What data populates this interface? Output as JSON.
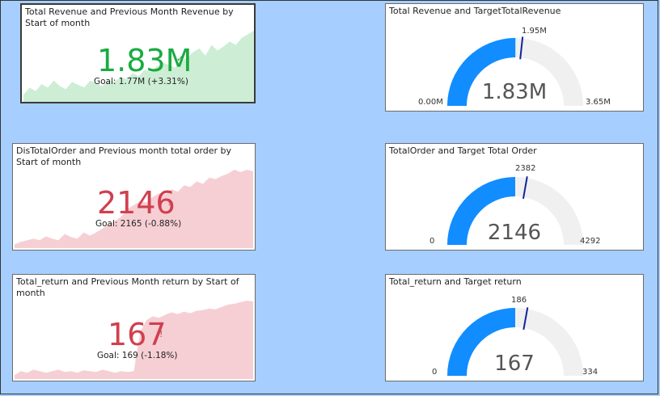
{
  "colors": {
    "green": "#1aab40",
    "green_fill": "#cdeed5",
    "red": "#d0404f",
    "red_fill": "#f6cfd4",
    "blue": "#118dff",
    "gauge_bg": "#f0f0f0",
    "target": "#12239e"
  },
  "kpis": [
    {
      "title": "Total Revenue and Previous Month Revenue by Start of month",
      "value": "1.83M",
      "indicator": "✓",
      "goal": "Goal: 1.77M (+3.31%)",
      "status": "good",
      "trend": [
        0.1,
        0.2,
        0.15,
        0.25,
        0.2,
        0.3,
        0.22,
        0.18,
        0.28,
        0.24,
        0.2,
        0.3,
        0.26,
        0.22,
        0.3,
        0.28,
        0.35,
        0.32,
        0.4,
        0.36,
        0.45,
        0.42,
        0.5,
        0.55,
        0.52,
        0.48,
        0.58,
        0.62,
        0.7,
        0.75,
        0.65,
        0.8,
        0.72,
        0.78,
        0.85,
        0.8,
        0.9,
        0.95,
        1.0
      ]
    },
    {
      "title": "DisTotalOrder and Previous month total order by Start of month",
      "value": "2146",
      "indicator": "!",
      "goal": "Goal: 2165 (-0.88%)",
      "status": "bad",
      "trend": [
        0.05,
        0.08,
        0.1,
        0.12,
        0.1,
        0.15,
        0.12,
        0.1,
        0.18,
        0.14,
        0.12,
        0.2,
        0.16,
        0.2,
        0.25,
        0.3,
        0.35,
        0.4,
        0.5,
        0.55,
        0.6,
        0.58,
        0.65,
        0.7,
        0.68,
        0.75,
        0.72,
        0.8,
        0.78,
        0.85,
        0.82,
        0.9,
        0.88,
        0.92,
        0.95,
        1.0,
        0.97,
        1.0,
        0.98
      ]
    },
    {
      "title": "Total_return and Previous Month return by Start of month",
      "value": "167",
      "indicator": "!",
      "goal": "Goal: 169 (-1.18%)",
      "status": "bad",
      "trend": [
        0.05,
        0.1,
        0.08,
        0.12,
        0.1,
        0.08,
        0.1,
        0.12,
        0.09,
        0.1,
        0.08,
        0.11,
        0.1,
        0.09,
        0.12,
        0.1,
        0.08,
        0.1,
        0.09,
        0.1,
        0.6,
        0.75,
        0.8,
        0.78,
        0.82,
        0.85,
        0.83,
        0.86,
        0.84,
        0.87,
        0.88,
        0.9,
        0.89,
        0.92,
        0.95,
        0.96,
        0.98,
        1.0,
        0.99
      ]
    }
  ],
  "gauges": [
    {
      "title": "Total Revenue and TargetTotalRevenue",
      "center": "1.83M",
      "min": "0.00M",
      "max": "3.65M",
      "target_label": "1.95M",
      "fraction": 0.501,
      "target_fraction": 0.534
    },
    {
      "title": "TotalOrder and Target Total Order",
      "center": "2146",
      "min": "0",
      "max": "4292",
      "target_label": "2382",
      "fraction": 0.5,
      "target_fraction": 0.555
    },
    {
      "title": "Total_return and Target return",
      "center": "167",
      "min": "0",
      "max": "334",
      "target_label": "186",
      "fraction": 0.5,
      "target_fraction": 0.557
    }
  ]
}
